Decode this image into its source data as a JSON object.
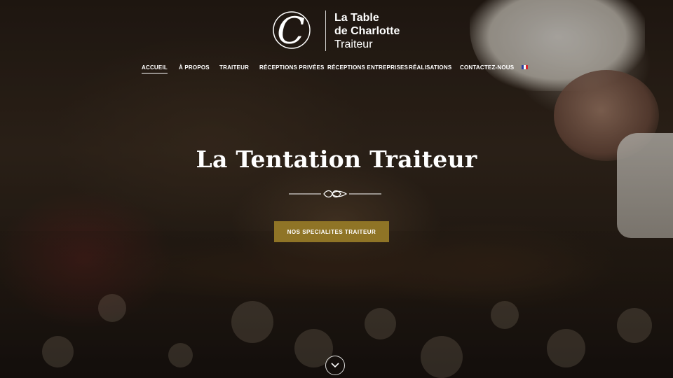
{
  "brand": {
    "line1": "La Table",
    "line2": "de Charlotte",
    "line3": "Traiteur",
    "monogram": "C"
  },
  "nav": {
    "items": [
      {
        "label": "ACCUEIL",
        "active": true
      },
      {
        "label": "À PROPOS",
        "active": false
      },
      {
        "label": "TRAITEUR",
        "active": false
      },
      {
        "label": "RÉCEPTIONS PRIVÉES",
        "active": false
      },
      {
        "label": "RÉCEPTIONS ENTREPRISES",
        "active": false
      },
      {
        "label": "RÉALISATIONS",
        "active": false
      },
      {
        "label": "CONTACTEZ-NOUS",
        "active": false
      }
    ],
    "language_flag": "fr-flag-icon"
  },
  "hero": {
    "title": "La Tentation Traiteur",
    "cta_label": "NOS SPECIALITES TRAITEUR",
    "scroll_icon": "chevron-down-icon"
  },
  "colors": {
    "accent_gold": "#8f7426",
    "text": "#ffffff",
    "flag_blue": "#2b3f9e",
    "flag_white": "#ffffff",
    "flag_red": "#d8262f"
  }
}
